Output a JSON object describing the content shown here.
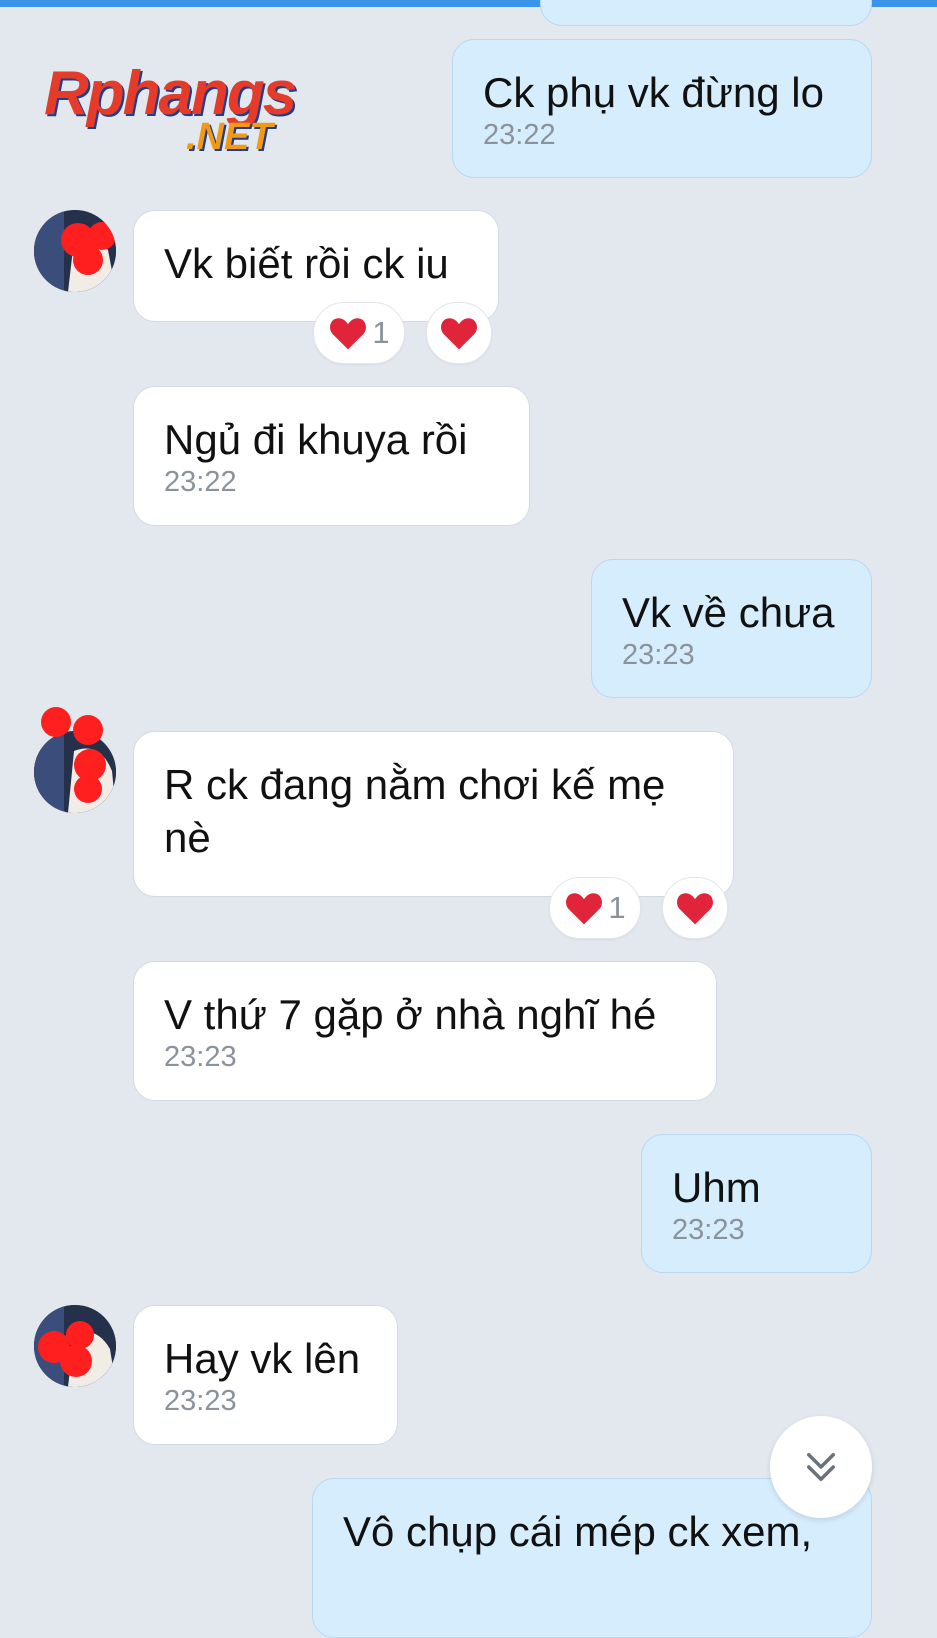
{
  "watermark": {
    "brand": "Rphangs",
    "tld": ".NET"
  },
  "colors": {
    "accent": "#3b93ea",
    "heart": "#e0243a",
    "incoming_bubble": "#ffffff",
    "outgoing_bubble": "#d6edfd"
  },
  "messages": [
    {
      "dir": "out",
      "text": "Ck phụ vk đừng lo",
      "time": "23:22"
    },
    {
      "dir": "in",
      "text": "Vk biết rồi ck iu",
      "reaction_count": "1"
    },
    {
      "dir": "in",
      "text": "Ngủ đi khuya rồi",
      "time": "23:22"
    },
    {
      "dir": "out",
      "text": "Vk về chưa",
      "time": "23:23"
    },
    {
      "dir": "in",
      "text": "R ck đang nằm chơi kế mẹ nè",
      "reaction_count": "1"
    },
    {
      "dir": "in",
      "text": "V thứ 7 gặp ở nhà nghĩ hé",
      "time": "23:23"
    },
    {
      "dir": "out",
      "text": "Uhm",
      "time": "23:23"
    },
    {
      "dir": "in",
      "text": "Hay vk lên",
      "time": "23:23"
    },
    {
      "dir": "out",
      "text": "Vô chụp cái mép ck xem,"
    }
  ],
  "icons": {
    "reaction": "heart-icon",
    "scroll": "chevron-double-down-icon"
  }
}
